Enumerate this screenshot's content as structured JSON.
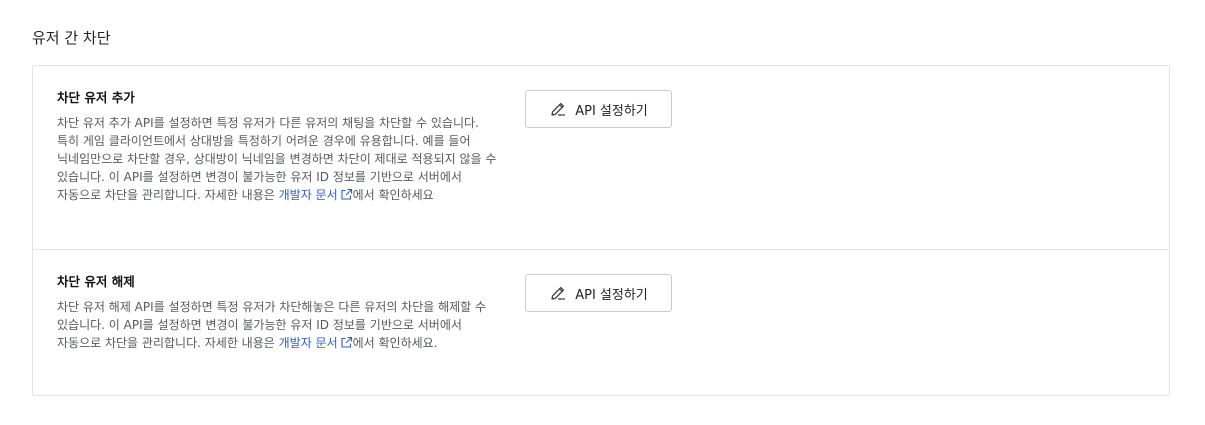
{
  "section": {
    "title": "유저 간 차단"
  },
  "rows": [
    {
      "title": "차단 유저 추가",
      "desc_before": "차단 유저 추가 API를 설정하면 특정 유저가 다른 유저의 채팅을 차단할 수 있습니다. 특히 게임 클라이언트에서 상대방을 특정하기 어려운 경우에 유용합니다. 예를 들어 닉네임만으로 차단할 경우, 상대방이 닉네임을 변경하면 차단이 제대로 적용되지 않을 수 있습니다. 이 API를 설정하면 변경이 불가능한 유저 ID 정보를 기반으로 서버에서 자동으로 차단을 관리합니다. 자세한 내용은 ",
      "link_text": "개발자 문서",
      "desc_after": "에서 확인하세요",
      "button_label": "API 설정하기"
    },
    {
      "title": "차단 유저 해제",
      "desc_before": "차단 유저 해제 API를 설정하면 특정 유저가 차단해놓은 다른 유저의 차단을 해제할 수 있습니다. 이 API를 설정하면 변경이 불가능한 유저 ID 정보를 기반으로 서버에서 자동으로 차단을 관리합니다. 자세한 내용은 ",
      "link_text": "개발자 문서",
      "desc_after": "에서 확인하세요.",
      "button_label": "API 설정하기"
    }
  ],
  "icons": {
    "button": "pencil-icon",
    "link": "external-link-icon"
  },
  "colors": {
    "link": "#2a5cd6",
    "border": "#e2e4e8",
    "button_border": "#c8ccd2"
  }
}
